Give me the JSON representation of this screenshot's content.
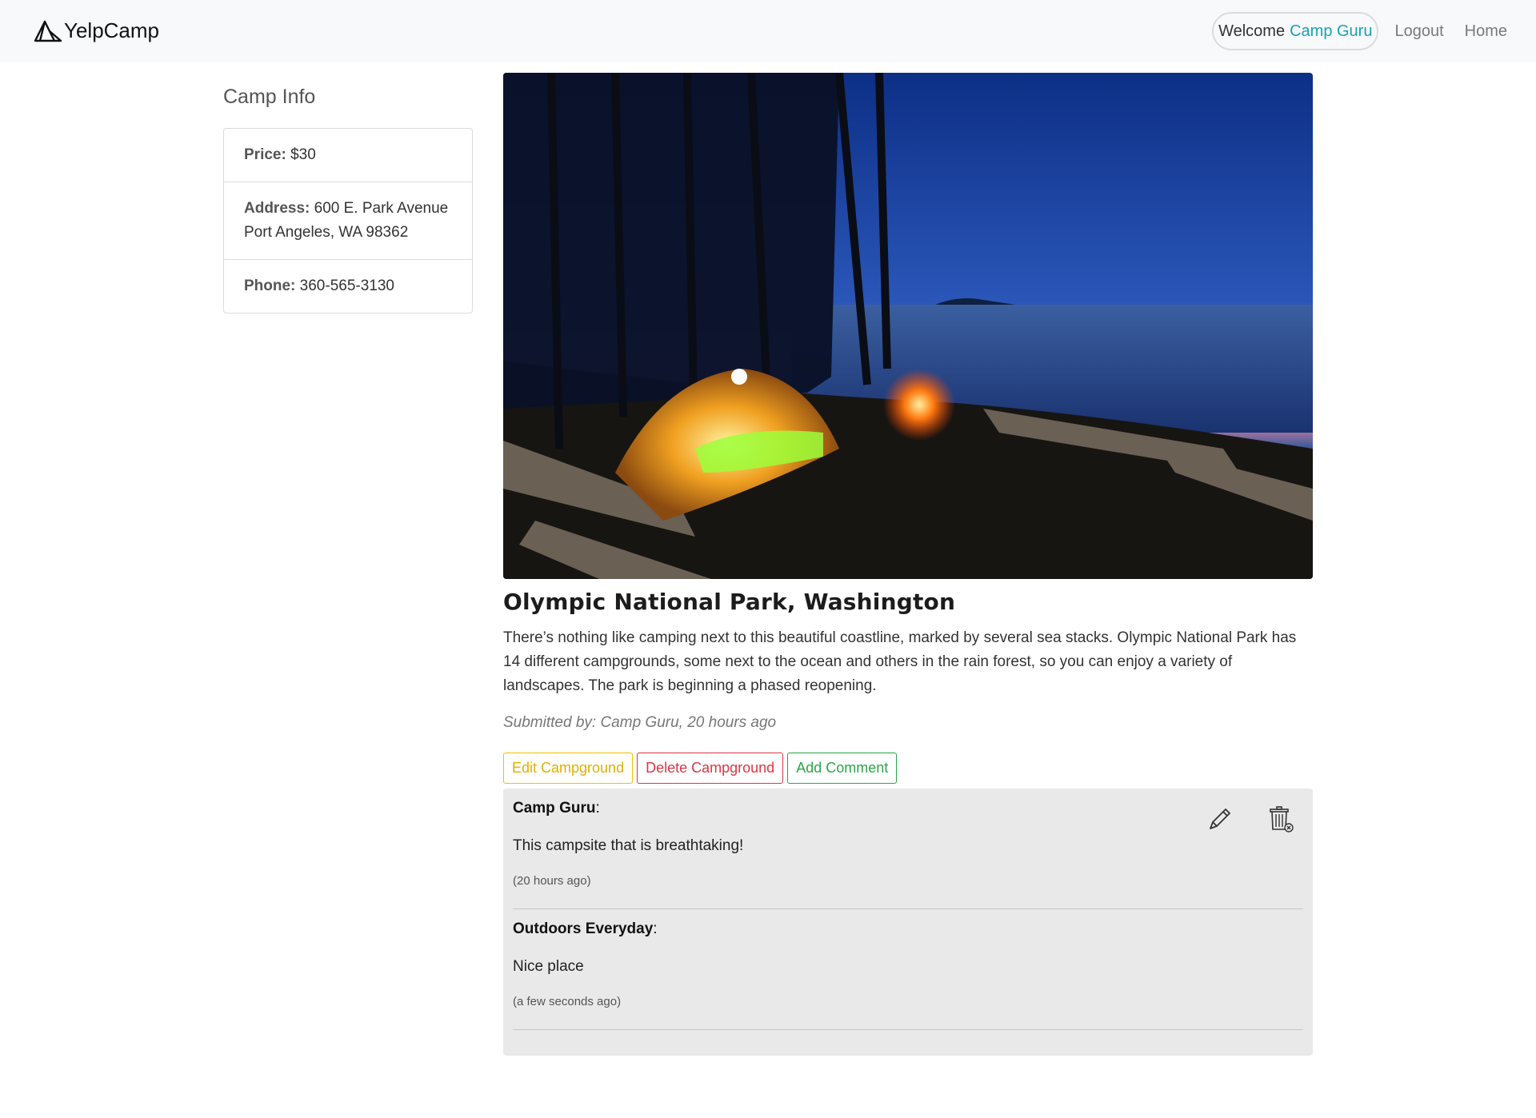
{
  "nav": {
    "brand": "YelpCamp",
    "welcome_prefix": "Welcome",
    "username": "Camp Guru",
    "logout": "Logout",
    "home": "Home"
  },
  "sidebar": {
    "heading": "Camp Info",
    "items": [
      {
        "label": "Price:",
        "value": "$30"
      },
      {
        "label": "Address:",
        "value": "600 E. Park Avenue Port Angeles, WA 98362"
      },
      {
        "label": "Phone:",
        "value": "360-565-3130"
      }
    ]
  },
  "campground": {
    "title": "Olympic National Park, Washington",
    "description": "There’s nothing like camping next to this beautiful coastline, marked by several sea stacks. Olympic National Park has 14 different campgrounds, some next to the ocean and others in the rain forest, so you can enjoy a variety of landscapes. The park is beginning a phased reopening.",
    "submitted": "Submitted by: Camp Guru, 20 hours ago"
  },
  "buttons": {
    "edit": "Edit Campground",
    "delete": "Delete Campground",
    "comment": "Add Comment"
  },
  "comments": [
    {
      "author": "Camp Guru",
      "text": "This campsite that is breathtaking!",
      "time": "(20 hours ago)"
    },
    {
      "author": "Outdoors Everyday",
      "text": "Nice place",
      "time": "(a few seconds ago)"
    }
  ],
  "colors": {
    "accent": "#17a2b8",
    "warning": "#f0c000",
    "danger": "#dc3545",
    "success": "#28a745"
  },
  "icons": {
    "brand": "tent-logo-icon",
    "edit": "pencil-icon",
    "delete": "trash-icon"
  }
}
